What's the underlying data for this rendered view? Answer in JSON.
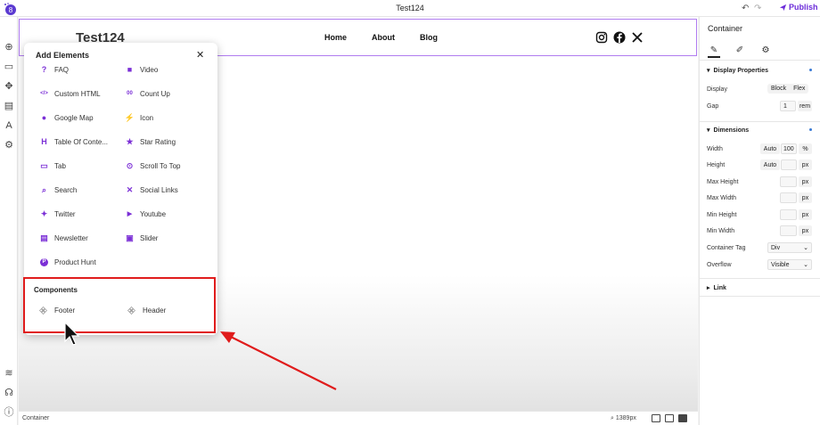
{
  "app": {
    "doc_title": "Test124",
    "publish_label": "Publish",
    "accent": "#6b2bd9"
  },
  "site": {
    "title": "Test124",
    "nav": [
      "Home",
      "About",
      "Blog"
    ],
    "social_icons": [
      "instagram-icon",
      "facebook-icon",
      "x-icon"
    ]
  },
  "add_elements": {
    "title": "Add Elements",
    "left_column": [
      {
        "label": "FAQ",
        "icon": "?"
      },
      {
        "label": "Custom HTML",
        "icon": "</>"
      },
      {
        "label": "Google Map",
        "icon": "●"
      },
      {
        "label": "Table Of Conte...",
        "icon": "H"
      },
      {
        "label": "Tab",
        "icon": "▭"
      },
      {
        "label": "Search",
        "icon": "⌕"
      },
      {
        "label": "Twitter",
        "icon": "✦"
      },
      {
        "label": "Newsletter",
        "icon": "▤"
      },
      {
        "label": "Product Hunt",
        "icon": "P"
      }
    ],
    "right_column": [
      {
        "label": "Video",
        "icon": "■"
      },
      {
        "label": "Count Up",
        "icon": "00"
      },
      {
        "label": "Icon",
        "icon": "⚡"
      },
      {
        "label": "Star Rating",
        "icon": "★"
      },
      {
        "label": "Scroll To Top",
        "icon": "⊙"
      },
      {
        "label": "Social Links",
        "icon": "✕"
      },
      {
        "label": "Youtube",
        "icon": "▶"
      },
      {
        "label": "Slider",
        "icon": "▣"
      }
    ],
    "components_title": "Components",
    "components": [
      "Footer",
      "Header"
    ]
  },
  "statusbar": {
    "label": "Container",
    "zoom": "1389px"
  },
  "props": {
    "title": "Container",
    "display_section": "Display Properties",
    "display_label": "Display",
    "display_options": [
      "Block",
      "Flex"
    ],
    "gap_label": "Gap",
    "gap_value": "1",
    "gap_unit": "rem",
    "dimensions_section": "Dimensions",
    "width_label": "Width",
    "width_mode": "Auto",
    "width_value": "100",
    "width_unit": "%",
    "height_label": "Height",
    "height_mode": "Auto",
    "height_unit": "px",
    "max_height_label": "Max Height",
    "max_width_label": "Max Width",
    "min_height_label": "Min Height",
    "min_width_label": "Min Width",
    "px": "px",
    "container_tag_label": "Container Tag",
    "container_tag_value": "Div",
    "overflow_label": "Overflow",
    "overflow_value": "Visible",
    "link_section": "Link"
  }
}
